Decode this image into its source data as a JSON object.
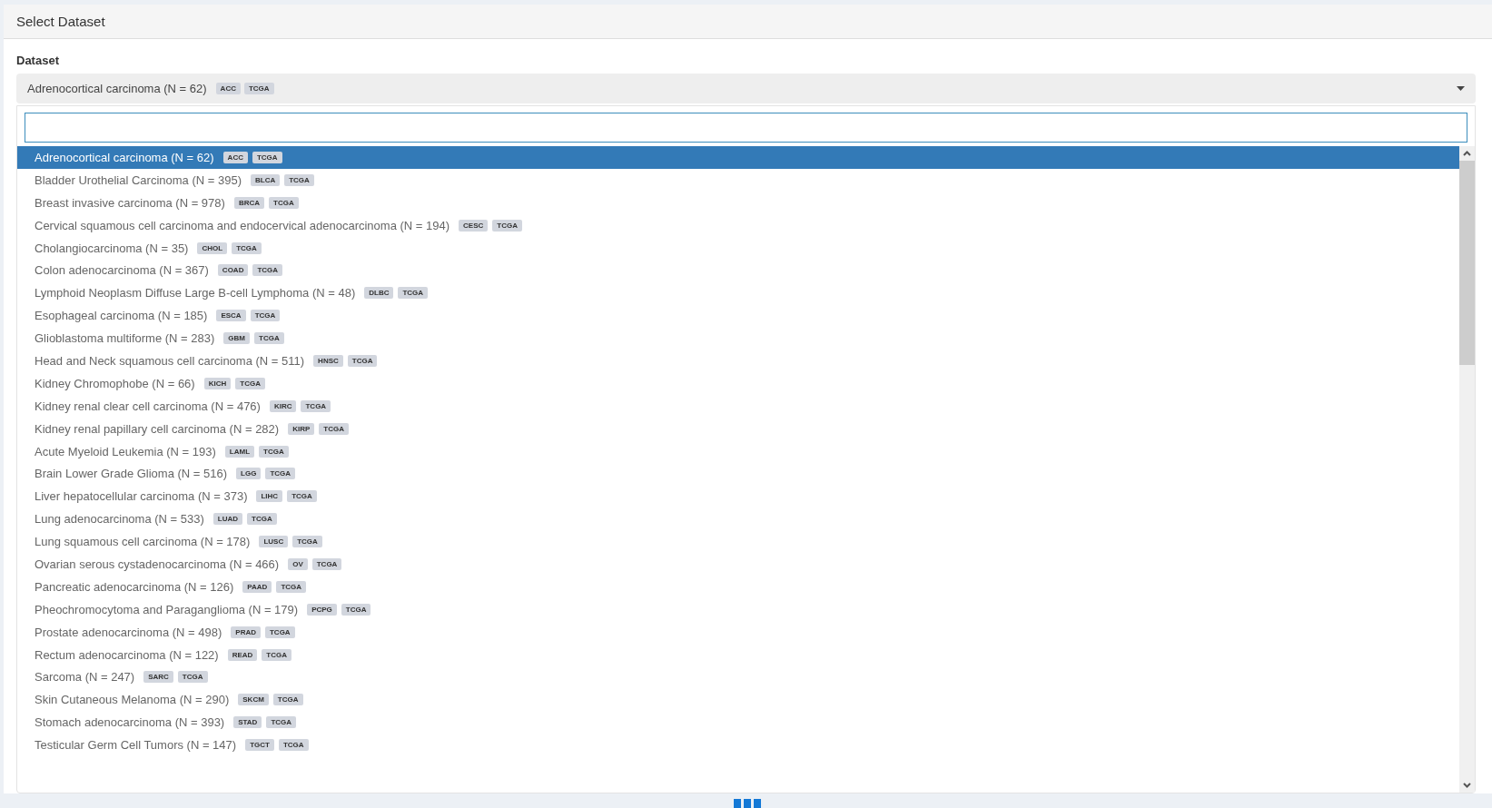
{
  "panel": {
    "title": "Select Dataset"
  },
  "dataset": {
    "label": "Dataset",
    "value": "Adrenocortical carcinoma (N = 62)",
    "tags": [
      "ACC",
      "TCGA"
    ]
  },
  "options": [
    {
      "label": "Adrenocortical carcinoma (N = 62)",
      "tags": [
        "ACC",
        "TCGA"
      ],
      "selected": true
    },
    {
      "label": "Bladder Urothelial Carcinoma (N = 395)",
      "tags": [
        "BLCA",
        "TCGA"
      ],
      "selected": false
    },
    {
      "label": "Breast invasive carcinoma (N = 978)",
      "tags": [
        "BRCA",
        "TCGA"
      ],
      "selected": false
    },
    {
      "label": "Cervical squamous cell carcinoma and endocervical adenocarcinoma (N = 194)",
      "tags": [
        "CESC",
        "TCGA"
      ],
      "selected": false
    },
    {
      "label": "Cholangiocarcinoma (N = 35)",
      "tags": [
        "CHOL",
        "TCGA"
      ],
      "selected": false
    },
    {
      "label": "Colon adenocarcinoma (N = 367)",
      "tags": [
        "COAD",
        "TCGA"
      ],
      "selected": false
    },
    {
      "label": "Lymphoid Neoplasm Diffuse Large B-cell Lymphoma (N = 48)",
      "tags": [
        "DLBC",
        "TCGA"
      ],
      "selected": false
    },
    {
      "label": "Esophageal carcinoma (N = 185)",
      "tags": [
        "ESCA",
        "TCGA"
      ],
      "selected": false
    },
    {
      "label": "Glioblastoma multiforme (N = 283)",
      "tags": [
        "GBM",
        "TCGA"
      ],
      "selected": false
    },
    {
      "label": "Head and Neck squamous cell carcinoma (N = 511)",
      "tags": [
        "HNSC",
        "TCGA"
      ],
      "selected": false
    },
    {
      "label": "Kidney Chromophobe (N = 66)",
      "tags": [
        "KICH",
        "TCGA"
      ],
      "selected": false
    },
    {
      "label": "Kidney renal clear cell carcinoma (N = 476)",
      "tags": [
        "KIRC",
        "TCGA"
      ],
      "selected": false
    },
    {
      "label": "Kidney renal papillary cell carcinoma (N = 282)",
      "tags": [
        "KIRP",
        "TCGA"
      ],
      "selected": false
    },
    {
      "label": "Acute Myeloid Leukemia (N = 193)",
      "tags": [
        "LAML",
        "TCGA"
      ],
      "selected": false
    },
    {
      "label": "Brain Lower Grade Glioma (N = 516)",
      "tags": [
        "LGG",
        "TCGA"
      ],
      "selected": false
    },
    {
      "label": "Liver hepatocellular carcinoma (N = 373)",
      "tags": [
        "LIHC",
        "TCGA"
      ],
      "selected": false
    },
    {
      "label": "Lung adenocarcinoma (N = 533)",
      "tags": [
        "LUAD",
        "TCGA"
      ],
      "selected": false
    },
    {
      "label": "Lung squamous cell carcinoma (N = 178)",
      "tags": [
        "LUSC",
        "TCGA"
      ],
      "selected": false
    },
    {
      "label": "Ovarian serous cystadenocarcinoma (N = 466)",
      "tags": [
        "OV",
        "TCGA"
      ],
      "selected": false
    },
    {
      "label": "Pancreatic adenocarcinoma (N = 126)",
      "tags": [
        "PAAD",
        "TCGA"
      ],
      "selected": false
    },
    {
      "label": "Pheochromocytoma and Paraganglioma (N = 179)",
      "tags": [
        "PCPG",
        "TCGA"
      ],
      "selected": false
    },
    {
      "label": "Prostate adenocarcinoma (N = 498)",
      "tags": [
        "PRAD",
        "TCGA"
      ],
      "selected": false
    },
    {
      "label": "Rectum adenocarcinoma (N = 122)",
      "tags": [
        "READ",
        "TCGA"
      ],
      "selected": false
    },
    {
      "label": "Sarcoma (N = 247)",
      "tags": [
        "SARC",
        "TCGA"
      ],
      "selected": false
    },
    {
      "label": "Skin Cutaneous Melanoma (N = 290)",
      "tags": [
        "SKCM",
        "TCGA"
      ],
      "selected": false
    },
    {
      "label": "Stomach adenocarcinoma (N = 393)",
      "tags": [
        "STAD",
        "TCGA"
      ],
      "selected": false
    },
    {
      "label": "Testicular Germ Cell Tumors (N = 147)",
      "tags": [
        "TGCT",
        "TCGA"
      ],
      "selected": false
    }
  ]
}
